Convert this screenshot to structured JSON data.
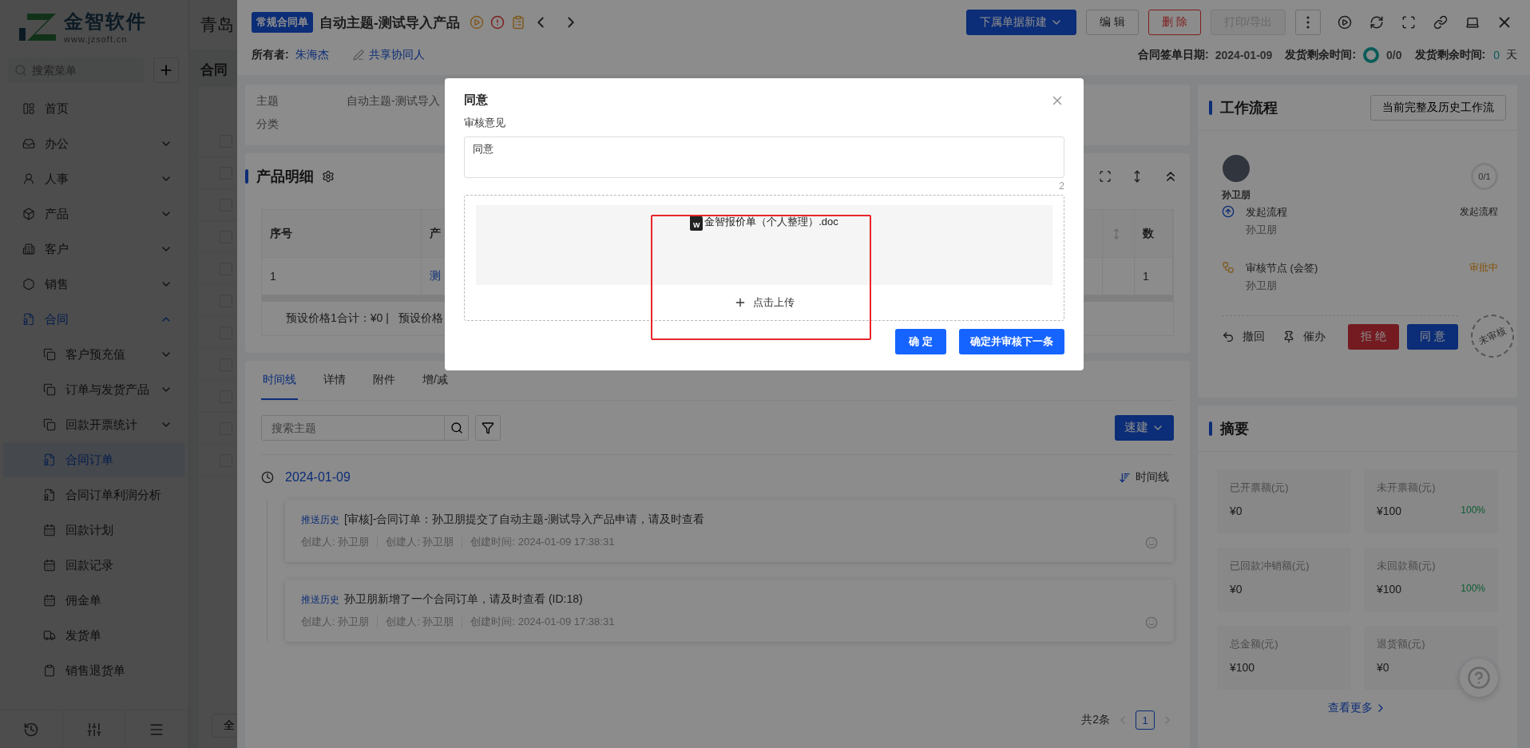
{
  "app": {
    "logo_name": "金智软件",
    "logo_url": "www.jzsoft.cn",
    "company": "青岛",
    "page_title": "合同",
    "bottom_button": "全"
  },
  "sidebar": {
    "search_placeholder": "搜索菜单",
    "items": [
      {
        "label": "首页",
        "selected": false
      },
      {
        "label": "办公",
        "expanded": false
      },
      {
        "label": "人事",
        "expanded": false
      },
      {
        "label": "产品",
        "expanded": false
      },
      {
        "label": "客户",
        "expanded": false
      },
      {
        "label": "销售",
        "expanded": false
      },
      {
        "label": "合同",
        "expanded": true,
        "children": [
          {
            "label": "客户预充值",
            "expanded": false
          },
          {
            "label": "订单与发货产品",
            "expanded": false
          },
          {
            "label": "回款开票统计",
            "expanded": false
          },
          {
            "label": "合同订单",
            "selected": true
          },
          {
            "label": "合同订单利润分析",
            "selected": false
          },
          {
            "label": "回款计划",
            "selected": false
          },
          {
            "label": "回款记录",
            "selected": false
          },
          {
            "label": "佣金单",
            "selected": false
          },
          {
            "label": "发货单",
            "selected": false
          },
          {
            "label": "销售退货单",
            "selected": false
          }
        ]
      }
    ]
  },
  "background_list": {
    "rows": [
      {
        "checked": false
      },
      {
        "checked": false
      },
      {
        "checked": false
      },
      {
        "checked": false
      },
      {
        "checked": false
      },
      {
        "checked": false
      },
      {
        "checked": false
      },
      {
        "checked": false
      },
      {
        "checked": false
      },
      {
        "checked": false
      },
      {
        "checked": false
      }
    ]
  },
  "header": {
    "tag": "常规合同单",
    "title": "自动主题-测试导入产品",
    "actions": [
      {
        "label": "下属单据新建",
        "kind": "primary"
      },
      {
        "label": "编 辑",
        "kind": "default"
      },
      {
        "label": "删 除",
        "kind": "danger"
      },
      {
        "label": "打印/导出",
        "kind": "disabled"
      }
    ],
    "owner_label": "所有者:",
    "owner": "朱海杰",
    "share": "共享协同人",
    "sign_date_label": "合同签单日期:",
    "sign_date": "2024-01-09",
    "ship_label": "发货剩余时间:",
    "ship_count": "0/0",
    "ship_days_label": "发货剩余时间:",
    "ship_days": "0",
    "ship_days_unit": "天"
  },
  "info": {
    "fields": [
      {
        "label": "主题",
        "value": "自动主题-测试导入"
      },
      {
        "label": "分类"
      }
    ]
  },
  "products": {
    "title": "产品明细",
    "columns": [
      "序号",
      "产",
      "数"
    ],
    "rows": [
      [
        "1",
        "测",
        "1"
      ]
    ],
    "totals": [
      "预设价格1合计：¥0 |",
      "预设价格"
    ]
  },
  "timeline": {
    "tabs": [
      {
        "label": "时间线",
        "selected": true
      },
      {
        "label": "详情",
        "selected": false
      },
      {
        "label": "附件",
        "selected": false
      },
      {
        "label": "增/减",
        "selected": false
      }
    ],
    "search_placeholder": "搜索主题",
    "quick_button": "速建",
    "date": "2024-01-09",
    "view_toggle": "时间线",
    "entries": [
      {
        "tag": "推送历史",
        "text": "[审核]-合同订单：孙卫朋提交了自动主题-测试导入产品申请，请及时查看",
        "meta": [
          "创建人: 孙卫朋",
          "创建人: 孙卫朋",
          "创建时间: 2024-01-09 17:38:31"
        ]
      },
      {
        "tag": "推送历史",
        "text": "孙卫朋新增了一个合同订单，请及时查看 (ID:18)",
        "meta": [
          "创建人: 孙卫朋",
          "创建人: 孙卫朋",
          "创建时间: 2024-01-09 17:38:31"
        ]
      }
    ],
    "pagination": {
      "total": "共2条",
      "pages": [
        {
          "label": "1",
          "selected": true
        }
      ]
    }
  },
  "workflow": {
    "title": "工作流程",
    "history_button": "当前完整及历史工作流",
    "initiator": "孙卫朋",
    "progress": "0/1",
    "steps": [
      {
        "name": "发起流程",
        "person": "孙卫朋",
        "status": "发起流程",
        "kind": "start"
      },
      {
        "name": "审核节点 (会签)",
        "person": "孙卫朋",
        "status": "审批中",
        "kind": "review"
      }
    ],
    "actions": [
      {
        "label": "撤回",
        "kind": "undo"
      },
      {
        "label": "催办",
        "kind": "pin"
      },
      {
        "label": "拒 绝",
        "kind": "danger"
      },
      {
        "label": "同 意",
        "kind": "primary"
      }
    ],
    "stamp": "未审核"
  },
  "summary": {
    "title": "摘要",
    "cells": [
      {
        "label": "已开票额(元)",
        "value": "¥0"
      },
      {
        "label": "未开票额(元)",
        "value": "¥100",
        "percent": "100%"
      },
      {
        "label": "已回款冲销额(元)",
        "value": "¥0"
      },
      {
        "label": "未回款额(元)",
        "value": "¥100",
        "percent": "100%"
      },
      {
        "label": "总金额(元)",
        "value": "¥100"
      },
      {
        "label": "退货额(元)",
        "value": "¥0"
      }
    ],
    "more": "查看更多"
  },
  "modal": {
    "title": "同意",
    "opinion_label": "审核意见",
    "opinion": "同意",
    "char_count": "2",
    "files": [
      {
        "badge": "W",
        "name": "金智报价单（个人整理）.doc"
      }
    ],
    "upload": "点击上传",
    "buttons": [
      {
        "label": "确 定",
        "kind": "primary"
      },
      {
        "label": "确定并审核下一条",
        "kind": "primary"
      }
    ]
  }
}
